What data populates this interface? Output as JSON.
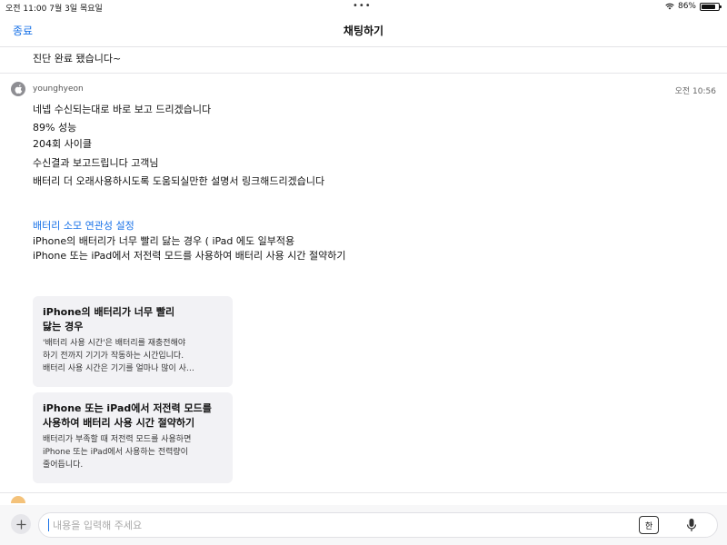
{
  "status_bar": {
    "time_date": "오전 11:00   7월 3일 목요일",
    "dots": "•••",
    "battery_text": "86%",
    "battery_level": 0.86
  },
  "nav": {
    "close_label": "종료",
    "title": "채팅하기"
  },
  "previous_message": "진단 완료 됐습니다~",
  "message": {
    "sender": "younghyeon",
    "time": "오전 10:56",
    "lines": [
      "네넵 수신되는대로 바로 보고 드리겠습니다",
      "89% 성능",
      "204회 사이클",
      "수신결과 보고드립니다 고객님",
      "배터리 더 오래사용하시도록 도움되실만한 설명서 링크해드리겠습니다"
    ],
    "link_title": "배터리 소모 연관성 설정",
    "link_lines": [
      "iPhone의 배터리가 너무 빨리 닳는 경우  ( iPad 에도 일부적용",
      "iPhone 또는 iPad에서 저전력 모드를 사용하여 배터리 사용 시간 절약하기"
    ],
    "cards": [
      {
        "title_line1": "iPhone의 배터리가 너무 빨리",
        "title_line2": "닳는 경우",
        "desc_line1": "'배터리 사용 시간'은 배터리를 재충전해야",
        "desc_line2": "하기 전까지 기기가 작동하는 시간입니다.",
        "desc_line3": "배터리 사용 시간은 기기를 얼마나 많이 사…"
      },
      {
        "title_line1": "iPhone 또는 iPad에서 저전력 모드를",
        "title_line2": "사용하여 배터리 사용 시간 절약하기",
        "desc_line1": "배터리가 부족할 때 저전력 모드를 사용하면",
        "desc_line2": "iPhone 또는 iPad에서 사용하는 전력량이",
        "desc_line3": "줄어듭니다."
      }
    ]
  },
  "input": {
    "placeholder": "내용을 입력해 주세요",
    "keyboard_label": "한"
  },
  "colors": {
    "accent": "#1a73e8",
    "card_bg": "#f2f2f5"
  },
  "icons": [
    "wifi-icon",
    "battery-icon",
    "apple-avatar-icon",
    "plus-icon",
    "keyboard-icon",
    "microphone-icon"
  ]
}
